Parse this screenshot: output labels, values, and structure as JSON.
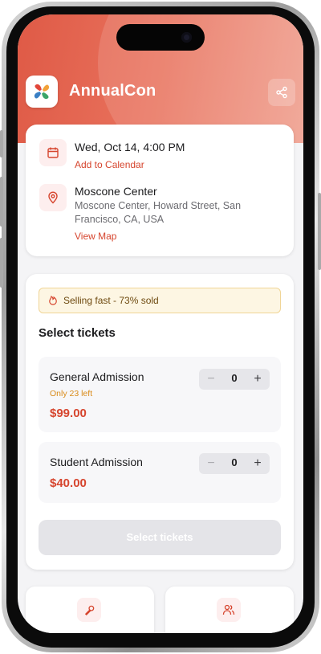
{
  "app": {
    "title": "AnnualCon"
  },
  "event": {
    "date": "Wed, Oct 14, 4:00 PM",
    "add_calendar": "Add to Calendar",
    "venue": "Moscone Center",
    "address": "Moscone Center, Howard Street, San Francisco, CA, USA",
    "view_map": "View Map"
  },
  "tickets": {
    "alert": "Selling fast - 73% sold",
    "sold_fraction": 0.73,
    "heading": "Select tickets",
    "items": [
      {
        "name": "General Admission",
        "availability": "Only 23 left",
        "price": "$99.00",
        "qty": "0"
      },
      {
        "name": "Student Admission",
        "availability": "",
        "price": "$40.00",
        "qty": "0"
      }
    ],
    "minus": "−",
    "plus": "+",
    "cta": "Select tickets"
  },
  "colors": {
    "accent": "#d6452e",
    "header": "#df5a46",
    "warning_bg": "#fdf6e3",
    "warning_text": "#6e4a10",
    "availability": "#d98a18"
  },
  "icons": {
    "share": "share-icon",
    "calendar": "calendar-icon",
    "location": "map-pin-icon",
    "fire": "flame-icon",
    "speaker": "microphone-icon",
    "attendees": "users-icon"
  }
}
